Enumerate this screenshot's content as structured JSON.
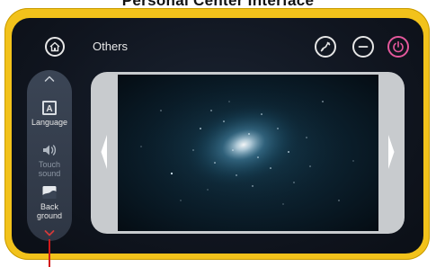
{
  "caption": "Personal Center Interface",
  "header": {
    "section_title": "Others",
    "icons": [
      "home-icon",
      "link-icon",
      "minus-icon",
      "power-icon"
    ],
    "power_color": "#e4589c"
  },
  "side_menu": {
    "items": [
      {
        "label": "Language",
        "icon": "language-icon",
        "active": true
      },
      {
        "label": "Touch sound",
        "icon": "speaker-icon",
        "active": false
      },
      {
        "label": "Back ground",
        "icon": "background-image-icon",
        "active": false
      }
    ]
  },
  "colors": {
    "frame": "#f2c21b",
    "screen": "#10151f",
    "pointer": "#d21a1a"
  }
}
